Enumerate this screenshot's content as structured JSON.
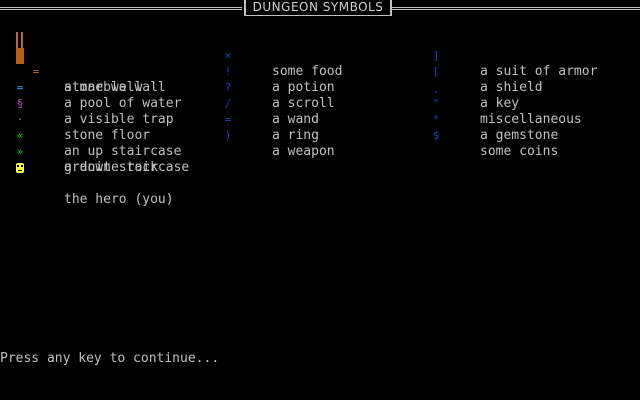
{
  "title": "DUNGEON SYMBOLS",
  "columns": [
    {
      "items": [
        {
          "symbol": "=",
          "label": "stone wall",
          "icon": "stone-wall-icon",
          "color": "#c07020"
        },
        {
          "symbol": "",
          "label": "a marble wall",
          "icon": "marble-wall-icon",
          "color": "#b86018"
        },
        {
          "symbol": "≈",
          "label": "a pool of water",
          "icon": "water-icon",
          "color": "#40a0ff"
        },
        {
          "symbol": "§",
          "label": "a visible trap",
          "icon": "trap-icon",
          "color": "#c040c0"
        },
        {
          "symbol": "·",
          "label": "stone floor",
          "icon": "floor-icon",
          "color": "#808080"
        },
        {
          "symbol": "«",
          "label": "an up staircase",
          "icon": "up-stair-icon",
          "color": "#40c040"
        },
        {
          "symbol": "»",
          "label": "a down staircase",
          "icon": "down-stair-icon",
          "color": "#40c040"
        },
        {
          "symbol": "",
          "label": "granite rock",
          "icon": "granite-icon",
          "color": "#000000"
        },
        {
          "symbol": "☻",
          "label": "the hero (you)",
          "icon": "hero-icon",
          "color": "#ffff40"
        }
      ]
    },
    {
      "items": [
        {
          "symbol": "×",
          "label": "some food",
          "icon": "food-icon",
          "color": "#2040c0"
        },
        {
          "symbol": "!",
          "label": "a potion",
          "icon": "potion-icon",
          "color": "#2040c0"
        },
        {
          "symbol": "?",
          "label": "a scroll",
          "icon": "scroll-icon",
          "color": "#2040c0"
        },
        {
          "symbol": "/",
          "label": "a wand",
          "icon": "wand-icon",
          "color": "#2040c0"
        },
        {
          "symbol": "=",
          "label": "a ring",
          "icon": "ring-icon",
          "color": "#2040c0"
        },
        {
          "symbol": ")",
          "label": "a weapon",
          "icon": "weapon-icon",
          "color": "#2040c0"
        }
      ]
    },
    {
      "items": [
        {
          "symbol": "]",
          "label": "a suit of armor",
          "icon": "armor-icon",
          "color": "#2040c0"
        },
        {
          "symbol": "[",
          "label": "a shield",
          "icon": "shield-icon",
          "color": "#2040c0"
        },
        {
          "symbol": "¸",
          "label": "a key",
          "icon": "key-icon",
          "color": "#2040c0"
        },
        {
          "symbol": "\"",
          "label": "miscellaneous",
          "icon": "misc-icon",
          "color": "#2040c0"
        },
        {
          "symbol": "*",
          "label": "a gemstone",
          "icon": "gem-icon",
          "color": "#2040c0"
        },
        {
          "symbol": "$",
          "label": "some coins",
          "icon": "coins-icon",
          "color": "#2040c0"
        }
      ]
    }
  ],
  "prompt": "Press any key to continue..."
}
